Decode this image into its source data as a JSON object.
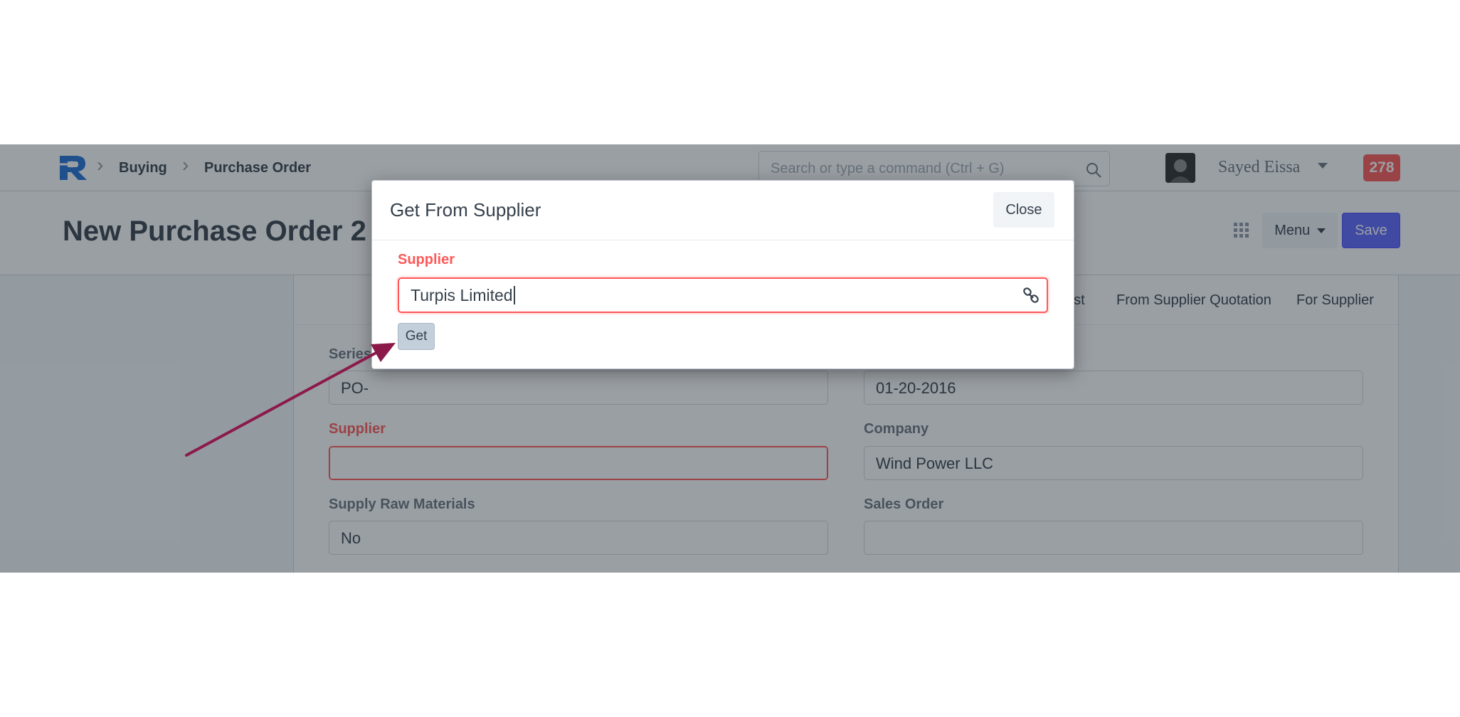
{
  "navbar": {
    "breadcrumbs": [
      "Buying",
      "Purchase Order"
    ],
    "search_placeholder": "Search or type a command (Ctrl + G)",
    "user_name": "Sayed Eissa",
    "notification_count": "278"
  },
  "page": {
    "title": "New Purchase Order 2",
    "menu_label": "Menu",
    "save_label": "Save"
  },
  "form": {
    "tabs": [
      "est",
      "From Supplier Quotation",
      "For Supplier"
    ],
    "fields": {
      "series": {
        "label": "Series",
        "value": "PO-"
      },
      "date": {
        "value": "01-20-2016"
      },
      "supplier": {
        "label": "Supplier",
        "value": ""
      },
      "company": {
        "label": "Company",
        "value": "Wind Power LLC"
      },
      "supply_raw_materials": {
        "label": "Supply Raw Materials",
        "value": "No"
      },
      "sales_order": {
        "label": "Sales Order",
        "value": ""
      }
    }
  },
  "modal": {
    "title": "Get From Supplier",
    "close_label": "Close",
    "supplier_label": "Supplier",
    "supplier_value": "Turpis Limited",
    "get_label": "Get"
  },
  "colors": {
    "accent": "#5e64ff",
    "required": "#ff5858",
    "annotation_arrow": "#8b1a4a"
  }
}
